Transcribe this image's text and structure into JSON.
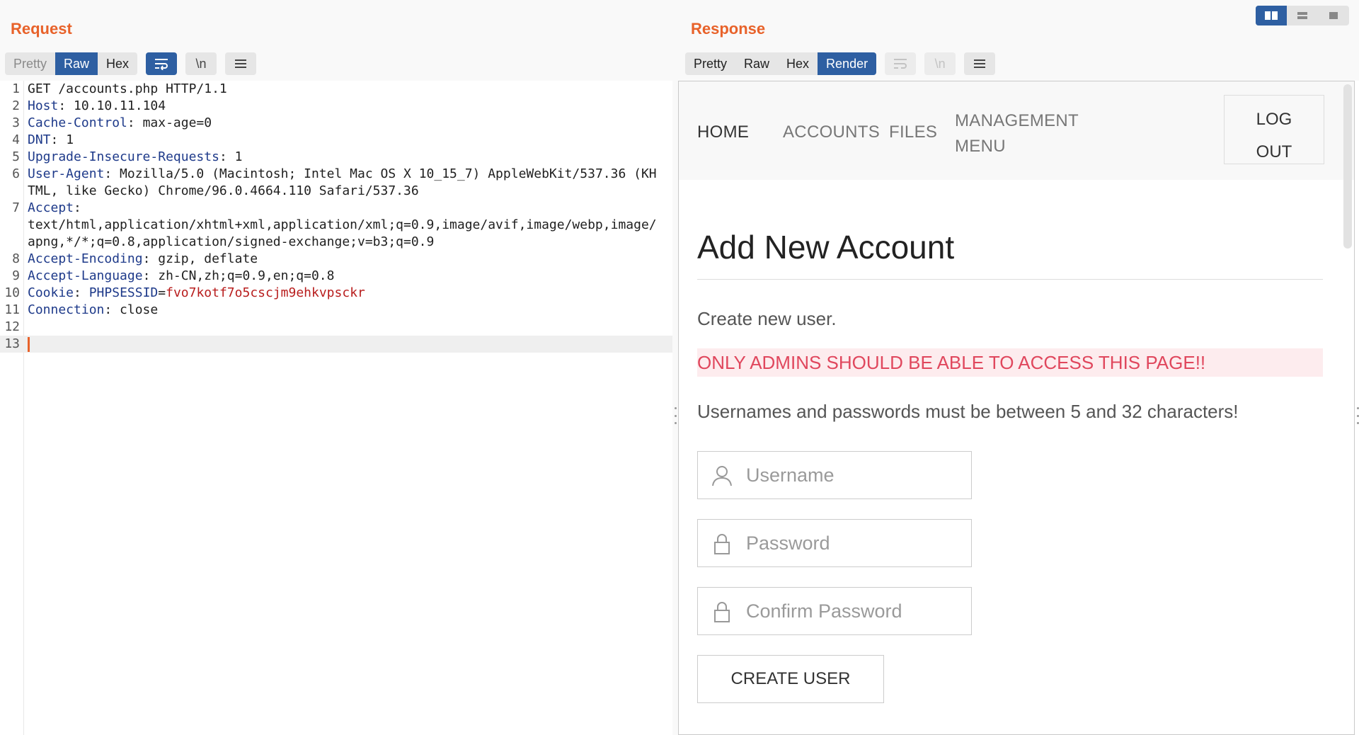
{
  "request": {
    "title": "Request",
    "tabs": [
      "Pretty",
      "Raw",
      "Hex"
    ],
    "newline_button": "\\n",
    "lines": [
      {
        "n": "1",
        "parts": [
          {
            "t": "GET /accounts.php HTTP/1.1",
            "c": "p"
          }
        ]
      },
      {
        "n": "2",
        "parts": [
          {
            "t": "Host",
            "c": "k"
          },
          {
            "t": ": 10.10.11.104",
            "c": "p"
          }
        ]
      },
      {
        "n": "3",
        "parts": [
          {
            "t": "Cache-Control",
            "c": "k"
          },
          {
            "t": ": max-age=0",
            "c": "p"
          }
        ]
      },
      {
        "n": "4",
        "parts": [
          {
            "t": "DNT",
            "c": "k"
          },
          {
            "t": ": 1",
            "c": "p"
          }
        ]
      },
      {
        "n": "5",
        "parts": [
          {
            "t": "Upgrade-Insecure-Requests",
            "c": "k"
          },
          {
            "t": ": 1",
            "c": "p"
          }
        ]
      },
      {
        "n": "6",
        "parts": [
          {
            "t": "User-Agent",
            "c": "k"
          },
          {
            "t": ": Mozilla/5.0 (Macintosh; Intel Mac OS X 10_15_7) AppleWebKit/537.36 (KHTML, like Gecko) Chrome/96.0.4664.110 Safari/537.36",
            "c": "p"
          }
        ]
      },
      {
        "n": "7",
        "parts": [
          {
            "t": "Accept",
            "c": "k"
          },
          {
            "t": ":\ntext/html,application/xhtml+xml,application/xml;q=0.9,image/avif,image/webp,image/apng,*/*;q=0.8,application/signed-exchange;v=b3;q=0.9",
            "c": "p"
          }
        ]
      },
      {
        "n": "8",
        "parts": [
          {
            "t": "Accept-Encoding",
            "c": "k"
          },
          {
            "t": ": gzip, deflate",
            "c": "p"
          }
        ]
      },
      {
        "n": "9",
        "parts": [
          {
            "t": "Accept-Language",
            "c": "k"
          },
          {
            "t": ": zh-CN,zh;q=0.9,en;q=0.8",
            "c": "p"
          }
        ]
      },
      {
        "n": "10",
        "parts": [
          {
            "t": "Cookie",
            "c": "k"
          },
          {
            "t": ": ",
            "c": "p"
          },
          {
            "t": "PHPSESSID",
            "c": "k"
          },
          {
            "t": "=",
            "c": "p"
          },
          {
            "t": "fvo7kotf7o5cscjm9ehkvpsckr",
            "c": "v"
          }
        ]
      },
      {
        "n": "11",
        "parts": [
          {
            "t": "Connection",
            "c": "k"
          },
          {
            "t": ": close",
            "c": "p"
          }
        ]
      },
      {
        "n": "12",
        "parts": []
      },
      {
        "n": "13",
        "parts": [],
        "current": true
      }
    ]
  },
  "response": {
    "title": "Response",
    "tabs": [
      "Pretty",
      "Raw",
      "Hex",
      "Render"
    ],
    "newline_button": "\\n",
    "rendered": {
      "nav": {
        "home": "HOME",
        "accounts": "ACCOUNTS",
        "files": "FILES",
        "management_line1": "MANAGEMENT",
        "management_line2": "MENU",
        "logout_line1": "LOG",
        "logout_line2": "OUT"
      },
      "heading": "Add New Account",
      "subtitle": "Create new user.",
      "warning": "ONLY ADMINS SHOULD BE ABLE TO ACCESS THIS PAGE!!",
      "rules": "Usernames and passwords must be between 5 and 32 characters!",
      "username_placeholder": "Username",
      "password_placeholder": "Password",
      "confirm_placeholder": "Confirm Password",
      "submit_label": "CREATE USER"
    }
  },
  "colors": {
    "accent_orange": "#e8622a",
    "active_blue": "#2e5fa2",
    "header_key": "#1e3a8a",
    "cookie_value": "#b81d1d",
    "warning_text": "#e0475d",
    "warning_bg": "#fdecee"
  }
}
